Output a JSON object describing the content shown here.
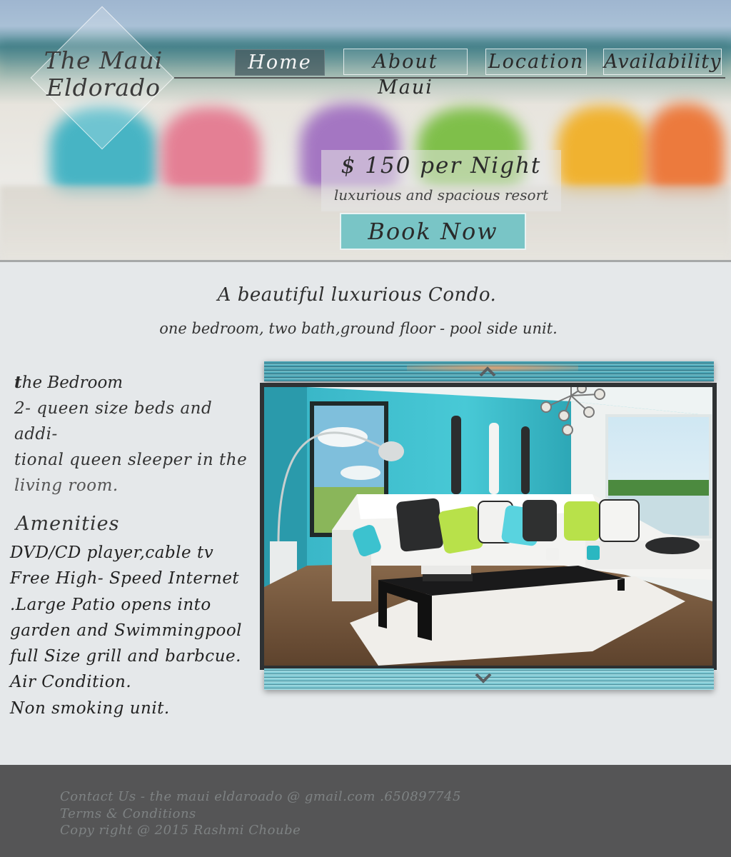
{
  "brand": {
    "name_line1": "The Maui",
    "name_line2": "Eldorado"
  },
  "nav": {
    "items": [
      {
        "label": "Home",
        "active": true
      },
      {
        "label": "About Maui",
        "active": false
      },
      {
        "label": "Location",
        "active": false
      },
      {
        "label": "Availability",
        "active": false
      }
    ]
  },
  "hero": {
    "price": "$ 150 per Night",
    "tagline": "luxurious and spacious resort",
    "cta_label": "Book Now"
  },
  "intro": {
    "headline": "A beautiful luxurious Condo.",
    "subhead": "one bedroom, two bath,ground floor - pool side unit."
  },
  "details": {
    "bedroom_title_first": "t",
    "bedroom_title_rest": "he Bedroom",
    "bedroom_lines": [
      "2- queen size beds and addi-",
      "tional queen sleeper in the",
      "living room."
    ],
    "amenities_title": "Amenities",
    "amenities": [
      "DVD/CD player,cable tv",
      "Free High- Speed Internet",
      ".Large Patio opens into",
      "garden and Swimmingpool",
      "full Size grill and barbcue.",
      "Air Condition.",
      "Non smoking unit."
    ]
  },
  "slider": {
    "prev_icon": "chevron-up-icon",
    "next_icon": "chevron-down-icon"
  },
  "footer": {
    "contact": "Contact Us - the maui eldaroado @ gmail.com .650897745",
    "terms": "Terms & Conditions",
    "copyright": "Copy right @ 2015 Rashmi Choube"
  },
  "colors": {
    "page_bg": "#e5e8ea",
    "accent_teal": "#79c5c6",
    "footer_bg": "#555556",
    "nav_active": "#465a5f",
    "wall_teal": "#3fc3d0"
  }
}
